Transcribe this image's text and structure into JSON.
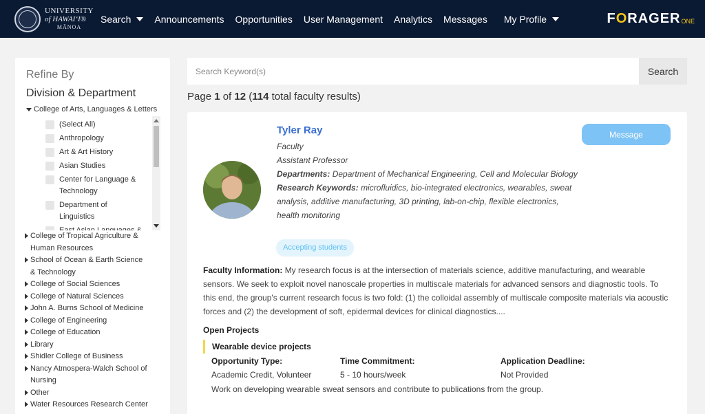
{
  "header": {
    "logo_line1": "UNIVERSITY",
    "logo_line2": "of HAWAI‘I®",
    "logo_line3": "MĀNOA",
    "nav": [
      {
        "label": "Search",
        "dropdown": true
      },
      {
        "label": "Announcements"
      },
      {
        "label": "Opportunities"
      },
      {
        "label": "User Management"
      },
      {
        "label": "Analytics"
      },
      {
        "label": "Messages"
      },
      {
        "label": "My Profile",
        "dropdown": true
      }
    ],
    "brand_pre": "F",
    "brand_o": "O",
    "brand_post": "RAGER",
    "brand_suffix": "ONE"
  },
  "sidebar": {
    "refine_label": "Refine By",
    "section_title": "Division & Department",
    "open_college": "College of Arts, Languages & Letters",
    "checklist": [
      "(Select All)",
      "Anthropology",
      "Art & Art History",
      "Asian Studies",
      "Center for Language & Technology",
      "Department of Linguistics",
      "East Asian Languages &"
    ],
    "colleges": [
      "College of Tropical Agriculture & Human Resources",
      "School of Ocean & Earth Science & Technology",
      "College of Social Sciences",
      "College of Natural Sciences",
      "John A. Burns School of Medicine",
      "College of Engineering",
      "College of Education",
      "Library",
      "Shidler College of Business",
      "Nancy Atmospera-Walch School of Nursing",
      "Other",
      "Water Resources Research Center"
    ]
  },
  "search": {
    "placeholder": "Search Keyword(s)",
    "button_label": "Search"
  },
  "results": {
    "prefix": "Page ",
    "page": "1",
    "of": " of ",
    "total_pages": "12",
    "open_paren": " (",
    "total_results": "114",
    "suffix": " total faculty results)"
  },
  "profile": {
    "name": "Tyler Ray",
    "role": "Faculty",
    "title": "Assistant Professor",
    "departments_label": "Departments:",
    "departments": "Department of Mechanical Engineering, Cell and Molecular Biology",
    "keywords_label": "Research Keywords:",
    "keywords": "microfluidics, bio-integrated electronics, wearables, sweat analysis, additive manufacturing, 3D printing, lab-on-chip, flexible electronics, health monitoring",
    "message_label": "Message",
    "badge": "Accepting students",
    "info_label": "Faculty Information:",
    "info_text": "My research focus is at the intersection of materials science, additive manufacturing, and wearable sensors. We seek to exploit novel nanoscale properties in multiscale materials for advanced sensors and diagnostic tools. To this end, the group's current research focus is two fold: (1) the colloidal assembly of multiscale composite materials via acoustic forces and (2) the development of soft, epidermal devices for clinical diagnostics....",
    "open_projects_label": "Open Projects",
    "project": {
      "title": "Wearable device projects",
      "opp_type_label": "Opportunity Type:",
      "opp_type": "Academic Credit, Volunteer",
      "time_label": "Time Commitment:",
      "time": "5 - 10 hours/week",
      "deadline_label": "Application Deadline:",
      "deadline": "Not Provided",
      "description": "Work on developing wearable sweat sensors and contribute to publications from the group."
    }
  },
  "colors": {
    "nav_bg": "#0b1a33",
    "link_blue": "#3b6fd1",
    "message_btn": "#7ec3f5",
    "badge_text": "#5cc0f0",
    "project_accent": "#f5d547"
  }
}
